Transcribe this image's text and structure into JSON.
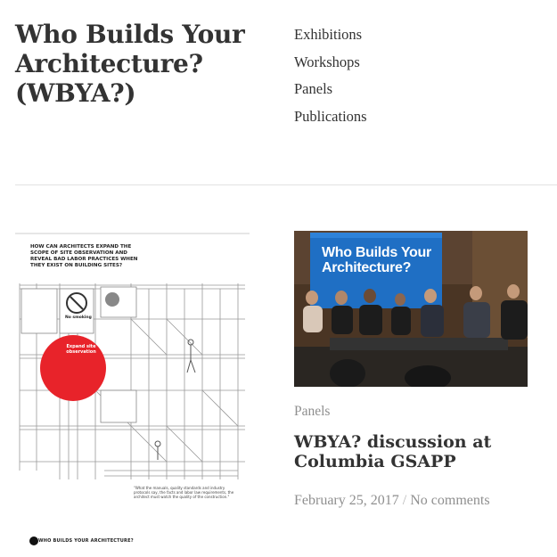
{
  "site": {
    "title": "Who Builds Your Architecture? (WBYA?)"
  },
  "nav": {
    "items": [
      "Exhibitions",
      "Workshops",
      "Panels",
      "Publications"
    ]
  },
  "poster": {
    "question": "How can architects expand the scope of site observation and reveal bad labor practices when they exist on building sites?",
    "circle_text": "Expand site observation",
    "sign_text": "No smoking",
    "quote": "\"What the manuals, quality standards and industry protocols say, the facts and labor law requirements, the architect must watch the quality of the construction.\"",
    "brand": "WHO BUILDS YOUR ARCHITECTURE?"
  },
  "post": {
    "image_title": "Who Builds Your Architecture?",
    "category": "Panels",
    "title": "WBYA? discussion at Columbia GSAPP",
    "date": "February 25, 2017",
    "separator": "/",
    "comments": "No comments"
  },
  "colors": {
    "circle": "#e8232a",
    "text": "#333333",
    "muted": "#8f8f8f"
  }
}
